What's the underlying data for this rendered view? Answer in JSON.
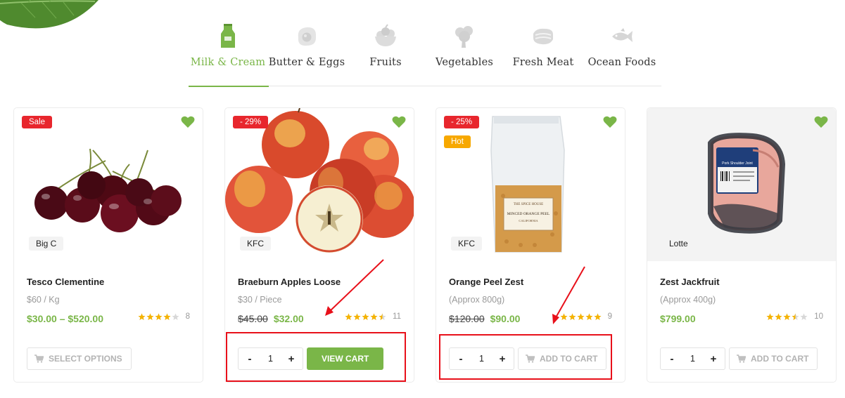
{
  "colors": {
    "accent": "#7ab648",
    "sale_red": "#e8262d",
    "hot_orange": "#f7a800",
    "star": "#f5b301",
    "annotation": "#e8101a"
  },
  "tabs": [
    {
      "label": "Milk & Cream",
      "icon": "milk-carton-icon",
      "active": true
    },
    {
      "label": "Butter & Eggs",
      "icon": "egg-icon",
      "active": false
    },
    {
      "label": "Fruits",
      "icon": "fruit-bowl-icon",
      "active": false
    },
    {
      "label": "Vegetables",
      "icon": "broccoli-icon",
      "active": false
    },
    {
      "label": "Fresh Meat",
      "icon": "steak-icon",
      "active": false
    },
    {
      "label": "Ocean Foods",
      "icon": "fish-icon",
      "active": false
    }
  ],
  "products": [
    {
      "badges": [
        "Sale"
      ],
      "vendor": "Big C",
      "name": "Tesco Clementine",
      "unit": "$60 / Kg",
      "price": "$30.00 – $520.00",
      "old_price": "",
      "rating": 4,
      "reviews": "8",
      "image": "cherries",
      "action": {
        "type": "select",
        "label": "SELECT OPTIONS"
      }
    },
    {
      "badges": [
        "- 29%"
      ],
      "vendor": "KFC",
      "name": "Braeburn Apples Loose",
      "unit": "$30 / Piece",
      "price": "$32.00",
      "old_price": "$45.00",
      "rating": 4.5,
      "reviews": "11",
      "image": "apples",
      "action": {
        "type": "qty",
        "qty": "1",
        "button": "VIEW CART"
      }
    },
    {
      "badges": [
        "- 25%",
        "Hot"
      ],
      "vendor": "KFC",
      "name": "Orange Peel Zest",
      "unit": "(Approx 800g)",
      "price": "$90.00",
      "old_price": "$120.00",
      "rating": 5,
      "reviews": "9",
      "image": "orange-peel-bag",
      "package_text": {
        "brand": "THE SPICE HOUSE",
        "title": "MINCED ORANGE PEEL",
        "sub": "CALIFORNIA"
      },
      "action": {
        "type": "qty",
        "qty": "1",
        "button": "ADD TO CART"
      }
    },
    {
      "badges": [],
      "vendor": "Lotte",
      "name": "Zest Jackfruit",
      "unit": "(Approx 400g)",
      "price": "$799.00",
      "old_price": "",
      "rating": 3.5,
      "reviews": "10",
      "image": "pork-shoulder",
      "package_text": {
        "label": "Pork Shoulder Joint"
      },
      "action": {
        "type": "qty",
        "qty": "1",
        "button": "ADD TO CART"
      }
    }
  ]
}
